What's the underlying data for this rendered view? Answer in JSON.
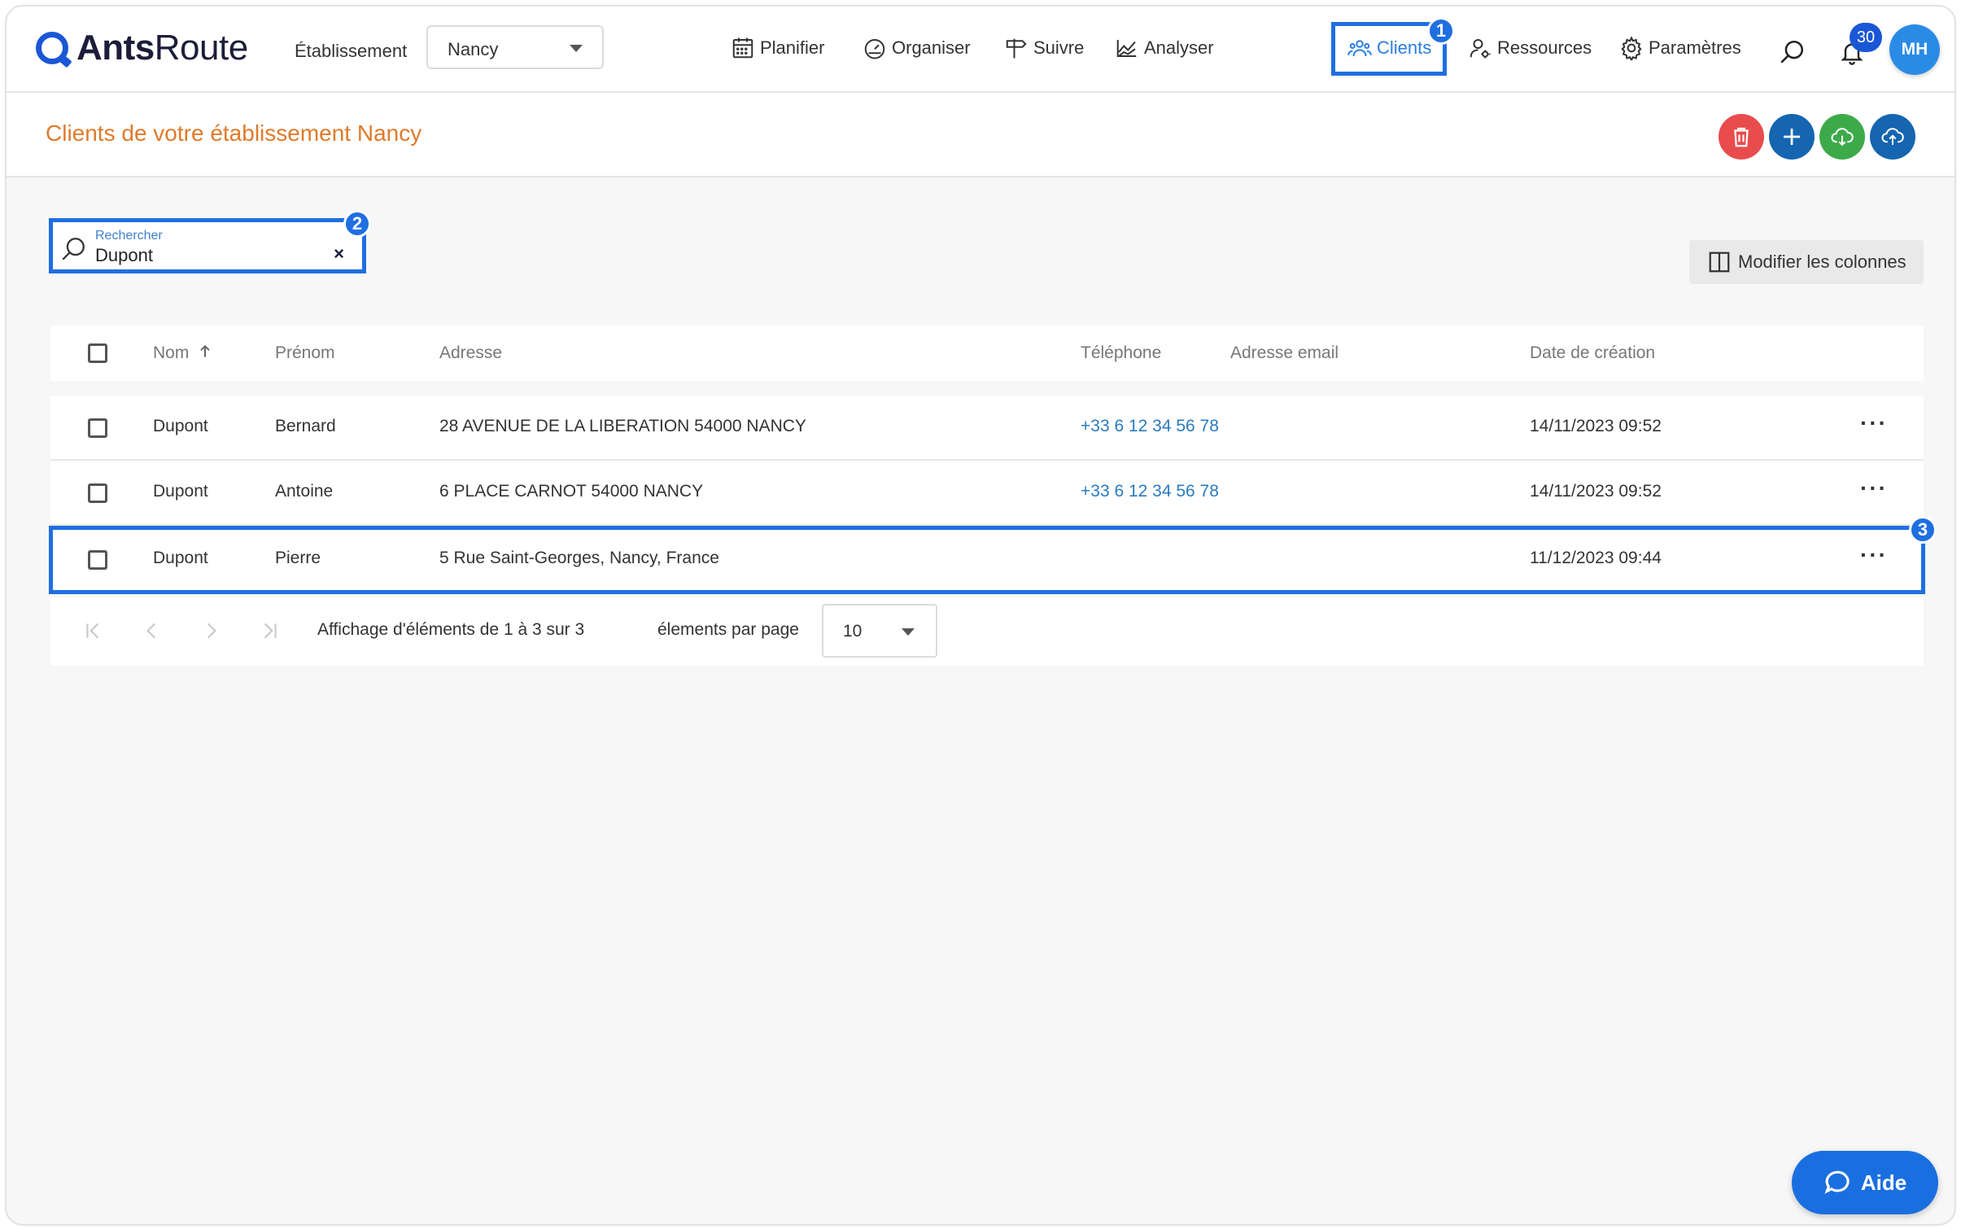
{
  "app": {
    "brand_bold": "Ants",
    "brand_light": "Route"
  },
  "header": {
    "etablissement_label": "Établissement",
    "etablissement_value": "Nancy",
    "nav": [
      {
        "label": "Planifier",
        "icon": "calendar-icon"
      },
      {
        "label": "Organiser",
        "icon": "speedometer-icon"
      },
      {
        "label": "Suivre",
        "icon": "signpost-icon"
      },
      {
        "label": "Analyser",
        "icon": "chart-icon"
      },
      {
        "label": "Clients",
        "icon": "users-icon"
      },
      {
        "label": "Ressources",
        "icon": "user-gear-icon"
      },
      {
        "label": "Paramètres",
        "icon": "gear-icon"
      }
    ],
    "notifications_count": "30",
    "avatar_initials": "MH"
  },
  "annotations": [
    "1",
    "2",
    "3"
  ],
  "page": {
    "title": "Clients de votre établissement Nancy"
  },
  "toolbar": {
    "buttons": [
      {
        "icon": "trash-icon",
        "color": "#e84c4c"
      },
      {
        "icon": "plus-icon",
        "color": "#1565b0"
      },
      {
        "icon": "cloud-download-icon",
        "color": "#3daa4a"
      },
      {
        "icon": "cloud-upload-icon",
        "color": "#1565b0"
      }
    ],
    "modify_columns_label": "Modifier les colonnes"
  },
  "search": {
    "label": "Rechercher",
    "value": "Dupont",
    "clear": "×"
  },
  "table": {
    "headers": [
      "Nom",
      "Prénom",
      "Adresse",
      "Téléphone",
      "Adresse email",
      "Date de création"
    ],
    "rows": [
      {
        "nom": "Dupont",
        "prenom": "Bernard",
        "adresse": "28 AVENUE DE LA LIBERATION 54000 NANCY",
        "telephone": "+33 6 12 34 56 78",
        "email": "",
        "date": "14/11/2023 09:52"
      },
      {
        "nom": "Dupont",
        "prenom": "Antoine",
        "adresse": "6 PLACE CARNOT 54000 NANCY",
        "telephone": "+33 6 12 34 56 78",
        "email": "",
        "date": "14/11/2023 09:52"
      },
      {
        "nom": "Dupont",
        "prenom": "Pierre",
        "adresse": "5 Rue Saint-Georges, Nancy, France",
        "telephone": "",
        "email": "",
        "date": "11/12/2023 09:44"
      }
    ],
    "row_menu": "···"
  },
  "pagination": {
    "summary": "Affichage d'éléments de 1 à 3 sur 3",
    "per_page_label": "élements par page",
    "per_page_value": "10"
  },
  "help": {
    "label": "Aide"
  },
  "colors": {
    "accent": "#1f6fe0",
    "title": "#e07a2a",
    "link": "#2a7bbf"
  }
}
